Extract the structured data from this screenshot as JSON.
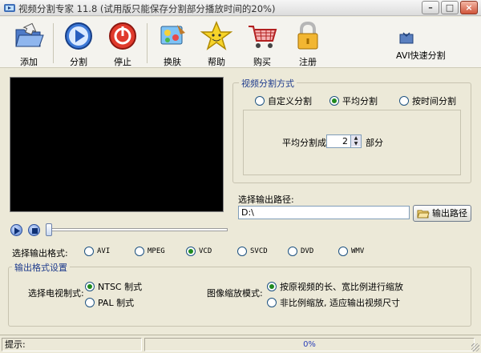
{
  "window": {
    "title": "视频分割专家 11.8 (试用版只能保存分割部分播放时间的20%)",
    "controls": [
      "–",
      "□",
      "×"
    ]
  },
  "toolbar": {
    "items": [
      {
        "label": "添加",
        "icon": "folder-open-icon"
      },
      {
        "label": "分割",
        "icon": "play-split-icon"
      },
      {
        "label": "停止",
        "icon": "stop-icon"
      },
      {
        "label": "换肤",
        "icon": "skin-icon"
      },
      {
        "label": "帮助",
        "icon": "star-help-icon"
      },
      {
        "label": "购买",
        "icon": "shopping-cart-icon"
      },
      {
        "label": "注册",
        "icon": "lock-icon"
      }
    ],
    "fast_split": "AVI快速分割"
  },
  "split_mode": {
    "title": "视频分割方式",
    "options": [
      "自定义分割",
      "平均分割",
      "按时间分割"
    ],
    "selected": "平均分割",
    "avg_label": "平均分割成",
    "avg_value": "2",
    "avg_unit": "部分"
  },
  "output_path": {
    "label": "选择输出路径:",
    "value": "D:\\",
    "button": "输出路径"
  },
  "output_format": {
    "label": "选择输出格式:",
    "options": [
      "AVI",
      "MPEG",
      "VCD",
      "SVCD",
      "DVD",
      "WMV"
    ],
    "selected": "VCD"
  },
  "format_settings": {
    "title": "输出格式设置",
    "tv_label": "选择电视制式:",
    "tv_options": [
      "NTSC 制式",
      "PAL  制式"
    ],
    "tv_selected": "NTSC 制式",
    "scale_label": "图像缩放模式:",
    "scale_options": [
      "按原视频的长、宽比例进行缩放",
      "非比例缩放, 适应输出视频尺寸"
    ],
    "scale_selected": "按原视频的长、宽比例进行缩放"
  },
  "status": {
    "hint_label": "提示:",
    "progress": "0%"
  },
  "colors": {
    "window_bg": "#ece9d8",
    "group_title": "#1d3a8c",
    "radio_on": "#1f8a1f",
    "progress_text": "#2a3fb8"
  }
}
